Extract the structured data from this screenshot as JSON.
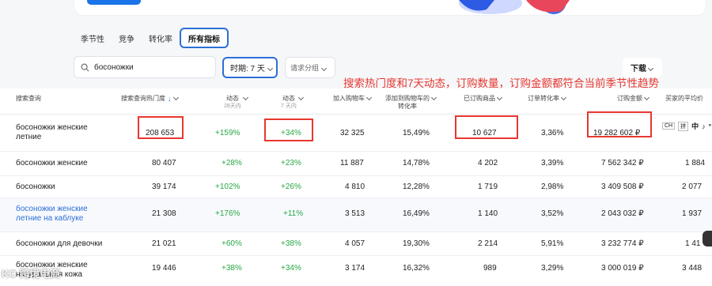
{
  "tabs": [
    "季节性",
    "竞争",
    "转化率",
    "所有指标"
  ],
  "search": {
    "value": "босоножки"
  },
  "period_label": "时期: 7 天",
  "group_label": "请求分组",
  "download_label": "下载",
  "annotation": "搜索热门度和7天动态，订购数量，订购金额都符合当前季节性趋势",
  "table": {
    "headers": {
      "query": "搜索查询",
      "popularity": "搜索查询热门度",
      "dyn1": "动态",
      "dyn1_sub": "28天内",
      "dyn2": "动态",
      "dyn2_sub": "7 天内",
      "cart": "加入购物车",
      "cart_conv_1": "添加到购物车的",
      "cart_conv_2": "转化率",
      "ordered": "已订购商品",
      "order_conv": "订单转化率",
      "amount": "订购金额",
      "avg_price": "买家的平均价"
    },
    "rows": [
      {
        "query": "босоножки женские летние",
        "popularity": "208 653",
        "dyn1": "+159%",
        "dyn2": "+34%",
        "cart": "32 325",
        "cart_conv": "15,49%",
        "ordered": "10 627",
        "order_conv": "3,36%",
        "amount": "19 282 602 ₽",
        "avg": ""
      },
      {
        "query": "босоножки женские",
        "popularity": "80 407",
        "dyn1": "+28%",
        "dyn2": "+23%",
        "cart": "11 887",
        "cart_conv": "14,78%",
        "ordered": "4 202",
        "order_conv": "3,39%",
        "amount": "7 562 342 ₽",
        "avg": "1 884"
      },
      {
        "query": "босоножки",
        "popularity": "39 174",
        "dyn1": "+102%",
        "dyn2": "+26%",
        "cart": "4 810",
        "cart_conv": "12,28%",
        "ordered": "1 719",
        "order_conv": "2,98%",
        "amount": "3 409 508 ₽",
        "avg": "2 077"
      },
      {
        "query": "босоножки женские летние на каблуке",
        "popularity": "21 308",
        "dyn1": "+176%",
        "dyn2": "+11%",
        "cart": "3 513",
        "cart_conv": "16,49%",
        "ordered": "1 140",
        "order_conv": "3,52%",
        "amount": "2 043 032 ₽",
        "avg": "1 937"
      },
      {
        "query": "босоножки для девочки",
        "popularity": "21 021",
        "dyn1": "+60%",
        "dyn2": "+38%",
        "cart": "4 057",
        "cart_conv": "19,30%",
        "ordered": "2 214",
        "order_conv": "5,91%",
        "amount": "3 232 774 ₽",
        "avg": "1 41"
      },
      {
        "query": "босоножки женские натуральная кожа",
        "popularity": "19 446",
        "dyn1": "+38%",
        "dyn2": "+34%",
        "cart": "3 174",
        "cart_conv": "16,32%",
        "ordered": "989",
        "order_conv": "3,29%",
        "amount": "3 000 019 ₽",
        "avg": "3 448"
      }
    ]
  },
  "ime": {
    "a": "CH",
    "b": "拼",
    "c": "中",
    "d": "♪",
    "e": "°"
  },
  "watermark": "KC 跨境电商"
}
